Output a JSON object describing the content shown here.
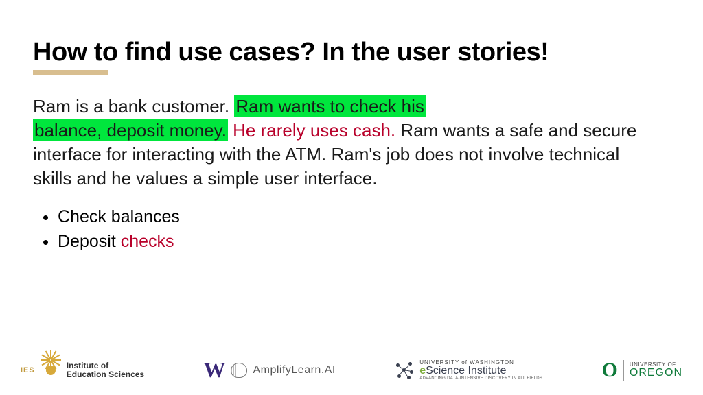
{
  "title": "How to find use cases?  In the user stories!",
  "story": {
    "s1": "Ram is a bank customer.  ",
    "s2": "Ram wants to check his ",
    "s3": "balance, deposit money.",
    "s4": " He rarely uses cash.",
    "s5": "  Ram wants a safe and secure interface for interacting with the ATM.  Ram's job does not involve technical skills and he values a simple user interface."
  },
  "bullets": {
    "b1a": "Check balances",
    "b2a": "Deposit ",
    "b2b": "checks"
  },
  "logos": {
    "ies": {
      "letters": "IES",
      "line1": "Institute of",
      "line2": "Education Sciences"
    },
    "uw": {
      "w": "W",
      "amp": "AmplifyLearn.AI"
    },
    "esci": {
      "top": "UNIVERSITY of WASHINGTON",
      "e": "e",
      "rest": "Science Institute",
      "sub": "ADVANCING DATA-INTENSIVE DISCOVERY IN ALL FIELDS"
    },
    "oregon": {
      "o": "O",
      "top": "UNIVERSITY OF",
      "main": "OREGON"
    }
  }
}
